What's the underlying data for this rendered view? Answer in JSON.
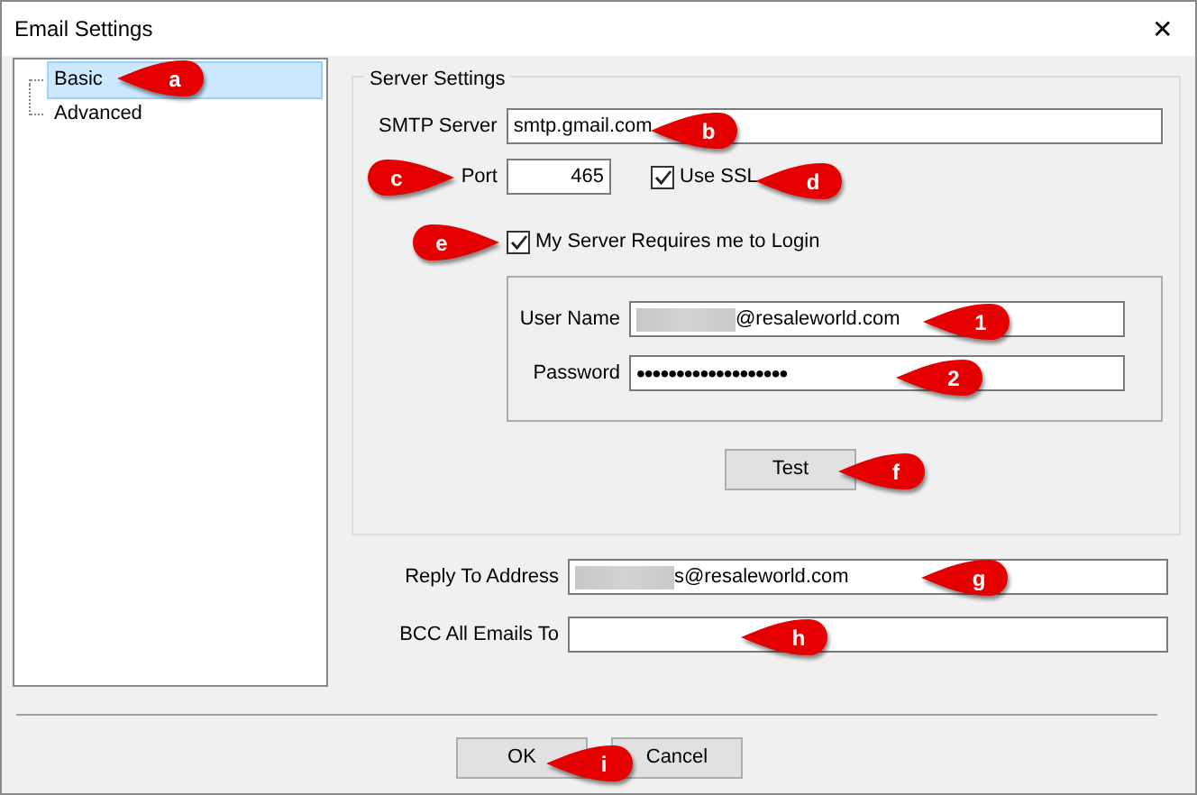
{
  "window": {
    "title": "Email Settings",
    "close": "✕"
  },
  "tree": [
    {
      "label": "Basic",
      "selected": true
    },
    {
      "label": "Advanced",
      "selected": false
    }
  ],
  "server_settings": {
    "title": "Server Settings",
    "smtp_server": {
      "label": "SMTP Server",
      "value": "smtp.gmail.com"
    },
    "port": {
      "label": "Port",
      "value": "465"
    },
    "use_ssl": {
      "label": "Use SSL",
      "checked": true
    },
    "requires_login": {
      "label": "My Server Requires me to Login",
      "checked": true
    },
    "user_name": {
      "label": "User Name",
      "value": "@resaleworld.com",
      "redacted": true
    },
    "password": {
      "label": "Password",
      "value": "•••••••••••••••••••"
    },
    "test_button": "Test"
  },
  "reply_to": {
    "label": "Reply To Address",
    "value": "s@resaleworld.com",
    "redacted": true
  },
  "bcc": {
    "label": "BCC All Emails To"
  },
  "buttons": [
    "OK",
    "Cancel"
  ],
  "callouts": [
    {
      "label": "a",
      "kind": "left"
    },
    {
      "label": "b",
      "kind": "left"
    },
    {
      "label": "c",
      "kind": "right"
    },
    {
      "label": "d",
      "kind": "left"
    },
    {
      "label": "e",
      "kind": "right"
    },
    {
      "label": "1",
      "kind": "left"
    },
    {
      "label": "2",
      "kind": "left"
    },
    {
      "label": "f",
      "kind": "left"
    },
    {
      "label": "g",
      "kind": "left"
    },
    {
      "label": "h",
      "kind": "left"
    },
    {
      "label": "i",
      "kind": "left"
    }
  ]
}
